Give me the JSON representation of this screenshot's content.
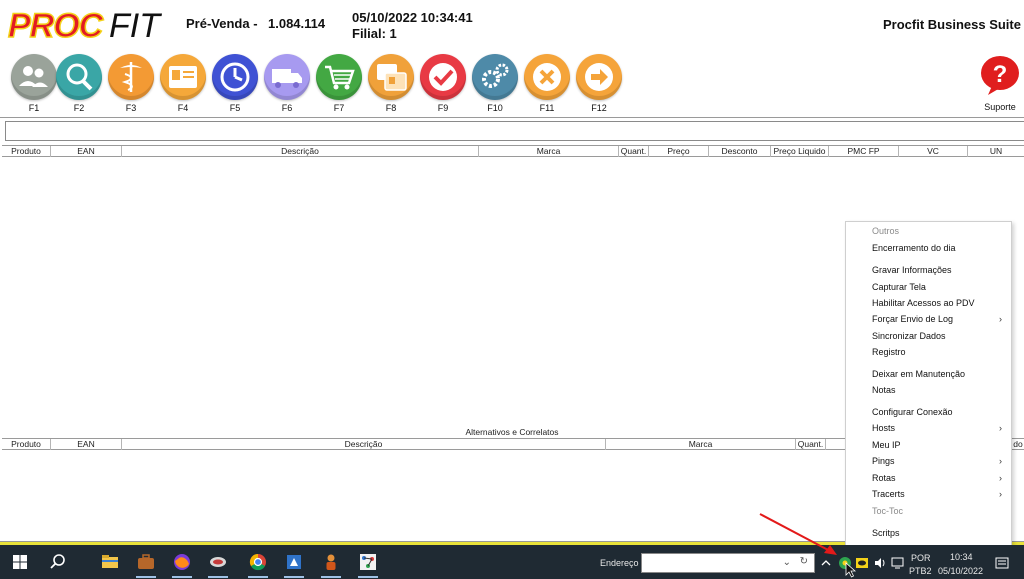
{
  "header": {
    "logo_text": "PROCFIT",
    "mode": "Pré-Venda -",
    "version": "1.084.114",
    "datetime": "05/10/2022 10:34:41",
    "branch": "Filial: 1",
    "suite": "Procfit Business Suite"
  },
  "fkeys": [
    {
      "label": "F1",
      "icon": "users-icon",
      "color": "#9aa39a"
    },
    {
      "label": "F2",
      "icon": "search-icon",
      "color": "#3aa6a6"
    },
    {
      "label": "F3",
      "icon": "caduceus-icon",
      "color": "#f39a34"
    },
    {
      "label": "F4",
      "icon": "id-card-icon",
      "color": "#f5a83a"
    },
    {
      "label": "F5",
      "icon": "clock-icon",
      "color": "#3f52d4"
    },
    {
      "label": "F6",
      "icon": "truck-icon",
      "color": "#a79af0"
    },
    {
      "label": "F7",
      "icon": "cart-icon",
      "color": "#43a843"
    },
    {
      "label": "F8",
      "icon": "cards-icon",
      "color": "#f0a13a"
    },
    {
      "label": "F9",
      "icon": "check-icon",
      "color": "#e83a44"
    },
    {
      "label": "F10",
      "icon": "gears-icon",
      "color": "#4e8aa8"
    },
    {
      "label": "F11",
      "icon": "x-icon",
      "color": "#f5a43a"
    },
    {
      "label": "F12",
      "icon": "arrow-right-icon",
      "color": "#f5a43a"
    }
  ],
  "support": {
    "label": "Suporte",
    "icon": "question-icon",
    "color": "#e01e1e"
  },
  "main_table": {
    "columns": [
      "Produto",
      "EAN",
      "Descrição",
      "Marca",
      "Quant.",
      "Preço",
      "Desconto",
      "Preço Liquido",
      "PMC FP",
      "VC",
      "UN"
    ]
  },
  "alt_table": {
    "caption": "Alternativos e Correlatos",
    "columns": [
      "Produto",
      "EAN",
      "Descrição",
      "Marca",
      "Quant.",
      "do"
    ]
  },
  "context_menu": {
    "items": [
      {
        "label": "Outros",
        "disabled": true,
        "submenu": false
      },
      {
        "label": "Encerramento do dia",
        "disabled": false,
        "submenu": false
      },
      {
        "label": "Gravar Informações",
        "disabled": false,
        "submenu": false
      },
      {
        "label": "Capturar Tela",
        "disabled": false,
        "submenu": false
      },
      {
        "label": "Habilitar Acessos ao PDV",
        "disabled": false,
        "submenu": false
      },
      {
        "label": "Forçar Envio de Log",
        "disabled": false,
        "submenu": true
      },
      {
        "label": "Sincronizar Dados",
        "disabled": false,
        "submenu": false
      },
      {
        "label": "Registro",
        "disabled": false,
        "submenu": false
      },
      {
        "label": "Deixar em Manutenção",
        "disabled": false,
        "submenu": false
      },
      {
        "label": "Notas",
        "disabled": false,
        "submenu": false
      },
      {
        "label": "Configurar Conexão",
        "disabled": false,
        "submenu": false
      },
      {
        "label": "Hosts",
        "disabled": false,
        "submenu": true
      },
      {
        "label": "Meu IP",
        "disabled": false,
        "submenu": false
      },
      {
        "label": "Pings",
        "disabled": false,
        "submenu": true
      },
      {
        "label": "Rotas",
        "disabled": false,
        "submenu": true
      },
      {
        "label": "Tracerts",
        "disabled": false,
        "submenu": true
      },
      {
        "label": "Toc-Toc",
        "disabled": true,
        "submenu": false
      },
      {
        "label": "Scritps",
        "disabled": false,
        "submenu": false
      }
    ]
  },
  "taskbar": {
    "address_label": "Endereço",
    "address_value": "",
    "lang_top": "POR",
    "lang_bottom": "PTB2",
    "time": "10:34",
    "date": "05/10/2022"
  },
  "colors": {
    "logo_red": "#e21b23",
    "logo_yellow": "#f4d21a",
    "taskbar_bg": "#1f2a33",
    "bottom_strip": "#e9e23a",
    "arrow_red": "#e31a1a"
  }
}
